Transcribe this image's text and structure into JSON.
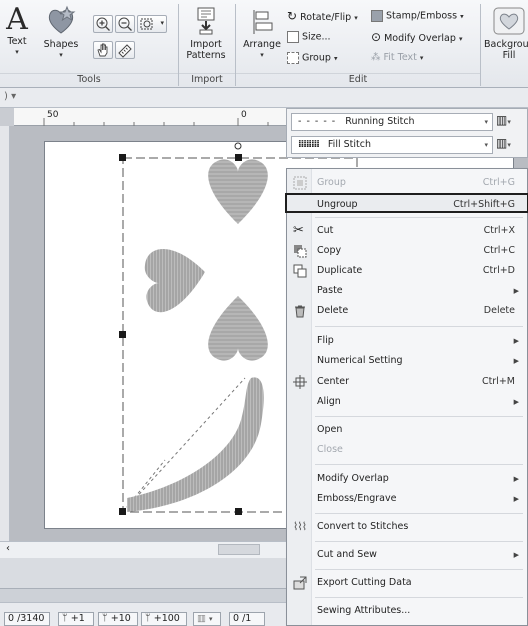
{
  "ribbon": {
    "text_label": "Text",
    "shapes_label": "Shapes",
    "tools_group": "Tools",
    "import_patterns_label": "Import Patterns",
    "import_group": "Import",
    "arrange_label": "Arrange",
    "rotate_flip_label": "Rotate/Flip",
    "size_label": "Size...",
    "group_label": "Group",
    "stamp_emboss_label": "Stamp/Emboss",
    "modify_overlap_label": "Modify Overlap",
    "fit_text_label": "Fit Text",
    "edit_group": "Edit",
    "background_fill_label": "Background Fill"
  },
  "ruler": {
    "mark_50": "50",
    "mark_0": "0"
  },
  "stitch_panel": {
    "running_stitch": "Running Stitch",
    "fill_stitch": "Fill Stitch"
  },
  "context_menu": {
    "items": [
      {
        "label": "Group",
        "shortcut": "Ctrl+G",
        "disabled": true
      },
      {
        "label": "Ungroup",
        "shortcut": "Ctrl+Shift+G",
        "highlighted": true
      },
      {
        "label": "Cut",
        "shortcut": "Ctrl+X"
      },
      {
        "label": "Copy",
        "shortcut": "Ctrl+C"
      },
      {
        "label": "Duplicate",
        "shortcut": "Ctrl+D"
      },
      {
        "label": "Paste",
        "submenu": true
      },
      {
        "label": "Delete",
        "shortcut": "Delete"
      },
      {
        "label": "Flip",
        "submenu": true
      },
      {
        "label": "Numerical Setting",
        "submenu": true
      },
      {
        "label": "Center",
        "shortcut": "Ctrl+M"
      },
      {
        "label": "Align",
        "submenu": true
      },
      {
        "label": "Open"
      },
      {
        "label": "Close",
        "disabled": true
      },
      {
        "label": "Modify Overlap",
        "submenu": true
      },
      {
        "label": "Emboss/Engrave",
        "submenu": true
      },
      {
        "label": "Convert to Stitches"
      },
      {
        "label": "Cut and Sew",
        "submenu": true
      },
      {
        "label": "Export Cutting Data"
      },
      {
        "label": "Sewing Attributes..."
      }
    ]
  },
  "statusbar": {
    "stitch_count": "0 /3140",
    "step_1": "+1",
    "step_10": "+10",
    "step_100": "+100",
    "page_counter": "0 /1"
  },
  "colors": {
    "ribbon_bg": "#eef0f3",
    "menu_highlight_border": "#1e1e1e",
    "pattern_gray": "#a8a8a8"
  }
}
